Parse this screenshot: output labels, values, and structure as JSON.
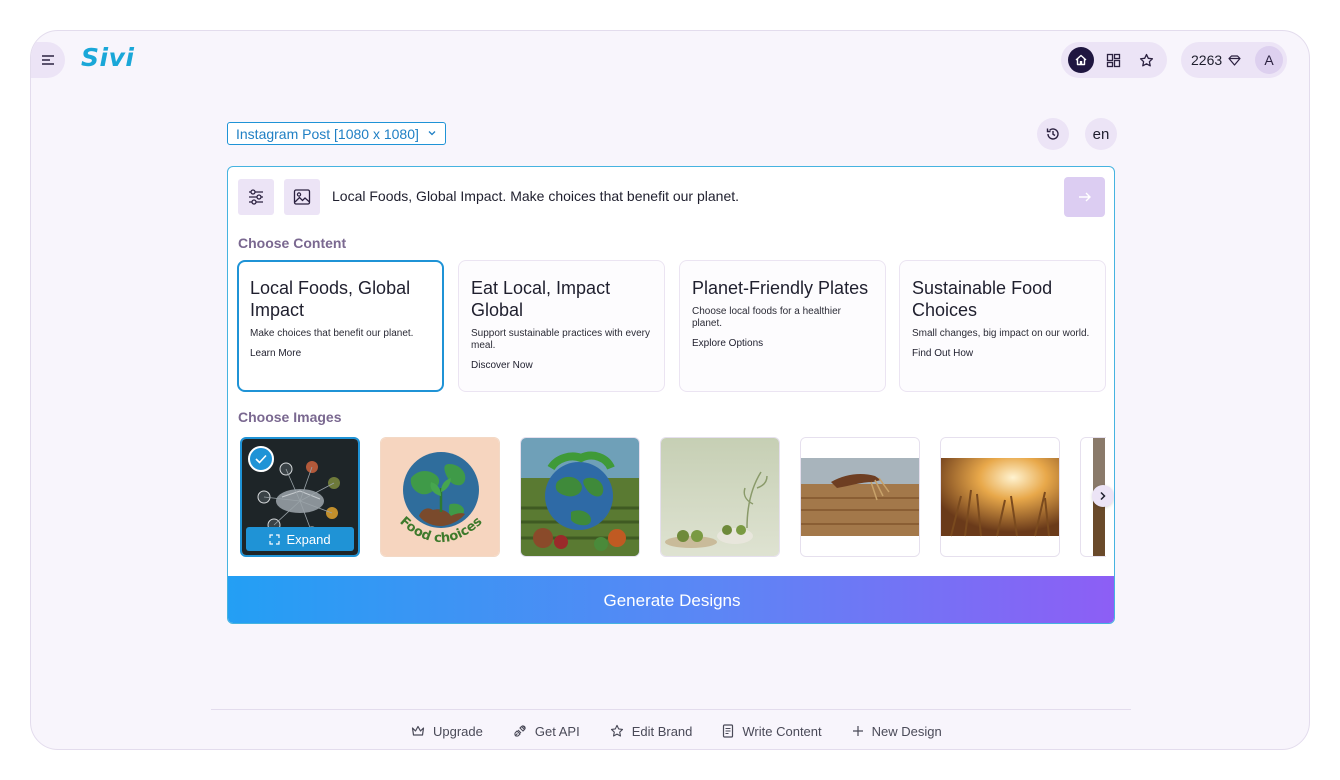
{
  "app": {
    "logo": "Sivi"
  },
  "header": {
    "credits": "2263",
    "avatar_initial": "A"
  },
  "format": {
    "selected": "Instagram Post [1080 x 1080]"
  },
  "language": "en",
  "prompt": {
    "value": "Local Foods, Global Impact. Make choices that benefit our planet."
  },
  "content": {
    "label": "Choose Content",
    "cards": [
      {
        "title": "Local Foods, Global Impact",
        "desc": "Make choices that benefit our planet.",
        "cta": "Learn More",
        "selected": true
      },
      {
        "title": "Eat Local, Impact Global",
        "desc": "Support sustainable practices with every meal.",
        "cta": "Discover Now",
        "selected": false
      },
      {
        "title": "Planet-Friendly Plates",
        "desc": "Choose local foods for a healthier planet.",
        "cta": "Explore Options",
        "selected": false
      },
      {
        "title": "Sustainable Food Choices",
        "desc": "Small changes, big impact on our world.",
        "cta": "Find Out How",
        "selected": false
      }
    ]
  },
  "images": {
    "label": "Choose Images",
    "expand_label": "Expand",
    "badge_text": "Food choices"
  },
  "generate": {
    "label": "Generate Designs"
  },
  "footer": {
    "items": [
      {
        "label": "Upgrade",
        "icon": "crown-icon"
      },
      {
        "label": "Get API",
        "icon": "plug-icon"
      },
      {
        "label": "Edit Brand",
        "icon": "star-icon"
      },
      {
        "label": "Write Content",
        "icon": "document-icon"
      },
      {
        "label": "New Design",
        "icon": "plus-icon"
      }
    ]
  },
  "colors": {
    "accent": "#1f93d6",
    "logo": "#1aa7d8",
    "panel": "#ece4f6",
    "gradient_start": "#239ff4",
    "gradient_end": "#8d5ef5"
  }
}
